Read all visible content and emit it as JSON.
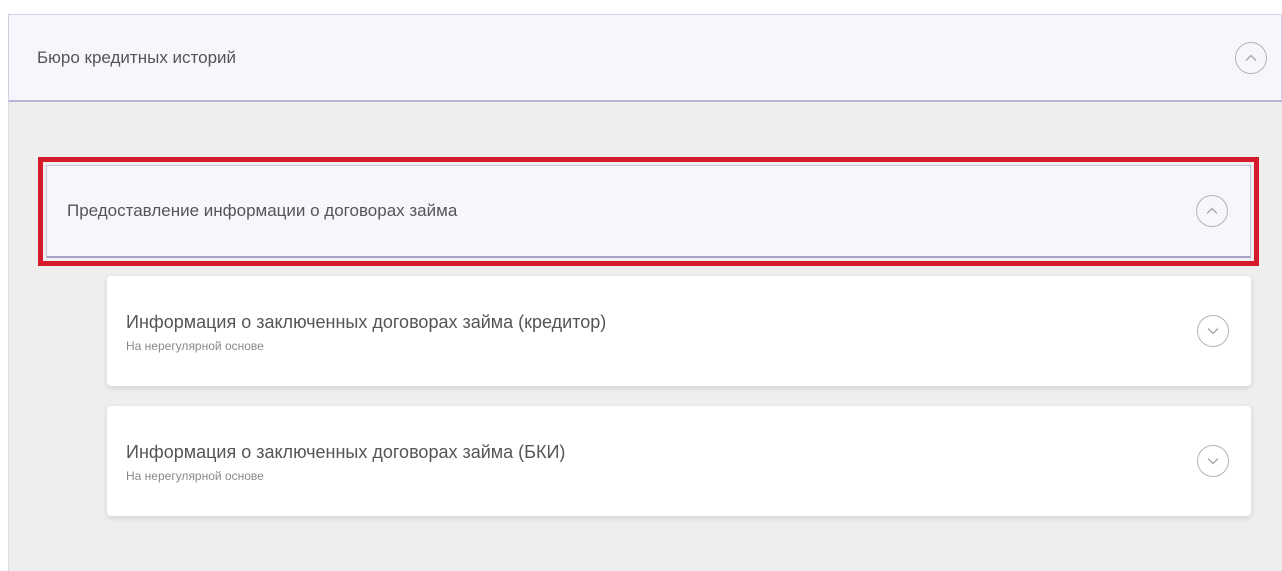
{
  "top_accordion": {
    "title": "Бюро кредитных историй",
    "toggle_icon": "chevron-up-circle-icon"
  },
  "section": {
    "title": "Предоставление информации о договорах займа",
    "toggle_icon": "chevron-up-circle-icon",
    "highlight_color": "#d61a29"
  },
  "items": [
    {
      "title": "Информация о заключенных договорах займа (кредитор)",
      "subtitle": "На нерегулярной основе",
      "toggle_icon": "chevron-down-circle-icon"
    },
    {
      "title": "Информация о заключенных договорах займа (БКИ)",
      "subtitle": "На нерегулярной основе",
      "toggle_icon": "chevron-down-circle-icon"
    }
  ]
}
